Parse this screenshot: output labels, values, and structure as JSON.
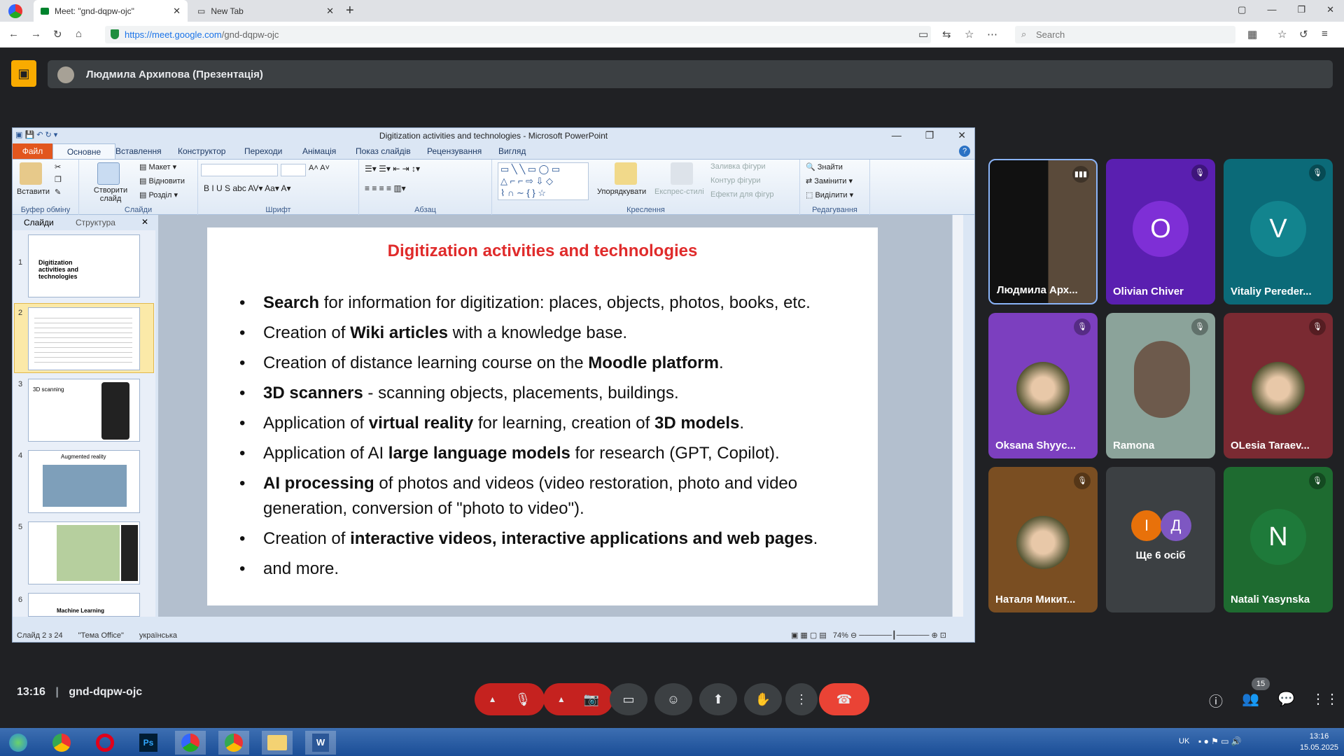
{
  "browser": {
    "tabs": [
      {
        "label": "Meet: \"gnd-dqpw-ojc\""
      },
      {
        "label": "New Tab"
      }
    ],
    "url": {
      "host": "https://meet.google.com",
      "path": "/gnd-dqpw-ojc"
    },
    "search_placeholder": "Search"
  },
  "meet": {
    "presenter": "Людмила Архипова (Презентація)",
    "time": "13:16",
    "code": "gnd-dqpw-ojc",
    "participant_badge": "15",
    "participants": [
      {
        "name": "Людмила Арх...",
        "type": "video",
        "color": "#2b2f36"
      },
      {
        "name": "Olivian Chiver",
        "initial": "O",
        "color": "#7e2fd6",
        "bg": "#5a1fb0"
      },
      {
        "name": "Vitaliy Pereder...",
        "initial": "V",
        "color": "#12848e",
        "bg": "#0b6a78"
      },
      {
        "name": "Oksana Shyyc...",
        "type": "photo",
        "bg": "#7c3fbf"
      },
      {
        "name": "Ramona",
        "type": "video",
        "bg": "#8ba39a"
      },
      {
        "name": "OLesia Taraev...",
        "type": "photo",
        "bg": "#7a2a32"
      },
      {
        "name": "Наталя Микит...",
        "type": "photo",
        "bg": "#7a4e22"
      },
      {
        "name": "Ще 6 осіб",
        "initials": [
          "І",
          "Д"
        ],
        "bg": "#3c4043"
      },
      {
        "name": "Natali Yasynska",
        "initial": "N",
        "color": "#1e7a3a",
        "bg": "#1e6b30"
      }
    ]
  },
  "ppt": {
    "window_title": "Digitization activities and technologies - Microsoft PowerPoint",
    "tabs": [
      "Файл",
      "Основне",
      "Вставлення",
      "Конструктор",
      "Переходи",
      "Анімація",
      "Показ слайдів",
      "Рецензування",
      "Вигляд"
    ],
    "groups": [
      "Буфер обміну",
      "Слайди",
      "Шрифт",
      "Абзац",
      "Креслення",
      "Редагування"
    ],
    "ribbon_items": {
      "paste": "Вставити",
      "new_slide": "Створити слайд",
      "layout": "Макет",
      "reset": "Відновити",
      "section": "Розділ",
      "arrange": "Упорядкувати",
      "quick_styles": "Експрес-стилі",
      "fill": "Заливка фігури",
      "outline": "Контур фігури",
      "effects": "Ефекти для фігур",
      "find": "Знайти",
      "replace": "Замінити",
      "select": "Виділити"
    },
    "pane_tabs": [
      "Слайди",
      "Структура"
    ],
    "thumbs": [
      "Digitization activities and technologies",
      "",
      "3D scanning",
      "Augmented reality",
      "",
      "Machine Learning"
    ],
    "slide": {
      "title": "Digitization activities and technologies",
      "bullets": [
        [
          "<b>Search</b> for information for digitization: places, objects, photos, books, etc."
        ],
        [
          "Creation of <b>Wiki articles</b> with a knowledge base."
        ],
        [
          "Creation of distance learning course on the <b>Moodle platform</b>."
        ],
        [
          "<b>3D scanners</b> - scanning objects, placements, buildings."
        ],
        [
          "Application of <b>virtual reality</b> for learning, creation of <b>3D models</b>."
        ],
        [
          "Application of AI <b>large language models</b> for research (GPT, Copilot)."
        ],
        [
          "<b>AI processing</b> of photos and videos (video restoration, photo and video generation, conversion of \"photo to video\")."
        ],
        [
          "Creation of <b>interactive videos, interactive applications and web pages</b>."
        ],
        [
          "and more."
        ]
      ]
    },
    "status": {
      "slide": "Слайд 2 з 24",
      "theme": "\"Тема Office\"",
      "lang": "українська",
      "zoom": "74%"
    }
  },
  "taskbar": {
    "lang": "UK",
    "time": "13:16",
    "date": "15.05.2025"
  }
}
